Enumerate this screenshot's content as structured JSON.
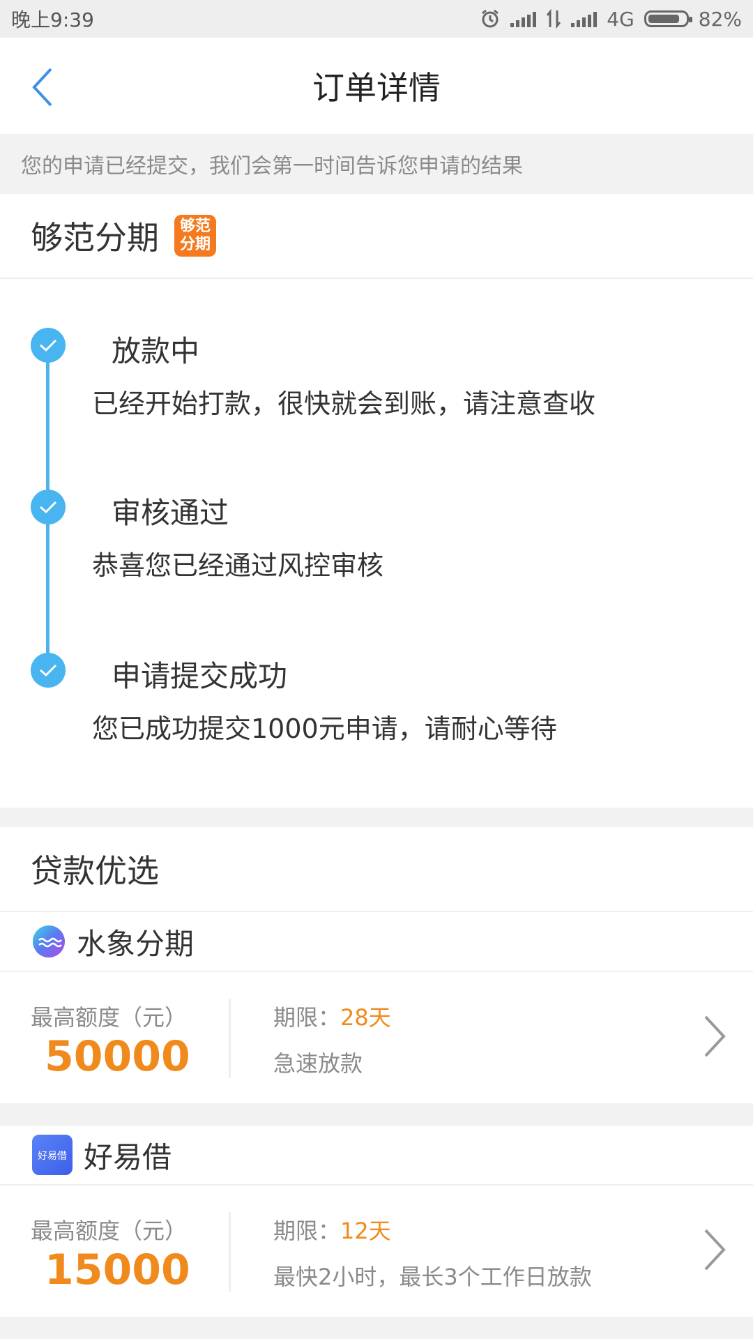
{
  "status_bar": {
    "time": "晚上9:39",
    "network": "4G",
    "battery": "82%",
    "icons": [
      "alarm-icon",
      "signal-icon",
      "data-transfer-icon",
      "signal-icon",
      "battery-icon"
    ]
  },
  "header": {
    "title": "订单详情",
    "back_icon": "chevron-left-icon"
  },
  "notice": "您的申请已经提交，我们会第一时间告诉您申请的结果",
  "lender": {
    "name": "够范分期",
    "logo_line1": "够范",
    "logo_line2": "分期"
  },
  "timeline": [
    {
      "title": "放款中",
      "desc": "已经开始打款，很快就会到账，请注意查收"
    },
    {
      "title": "审核通过",
      "desc": "恭喜您已经通过风控审核"
    },
    {
      "title": "申请提交成功",
      "desc": "您已成功提交1000元申请，请耐心等待"
    }
  ],
  "recommend": {
    "title": "贷款优选",
    "products": [
      {
        "name": "水象分期",
        "amount_label": "最高额度（元）",
        "amount": "50000",
        "term_label": "期限：",
        "term_value": "28天",
        "feature": "急速放款"
      },
      {
        "name": "好易借",
        "logo_text": "好易借",
        "amount_label": "最高额度（元）",
        "amount": "15000",
        "term_label": "期限：",
        "term_value": "12天",
        "feature": "最快2小时，最长3个工作日放款"
      }
    ]
  },
  "colors": {
    "accent_blue": "#48b4f0",
    "accent_orange": "#f08a1d",
    "logo_orange": "#f57a1f",
    "background_gray": "#f2f2f2"
  }
}
